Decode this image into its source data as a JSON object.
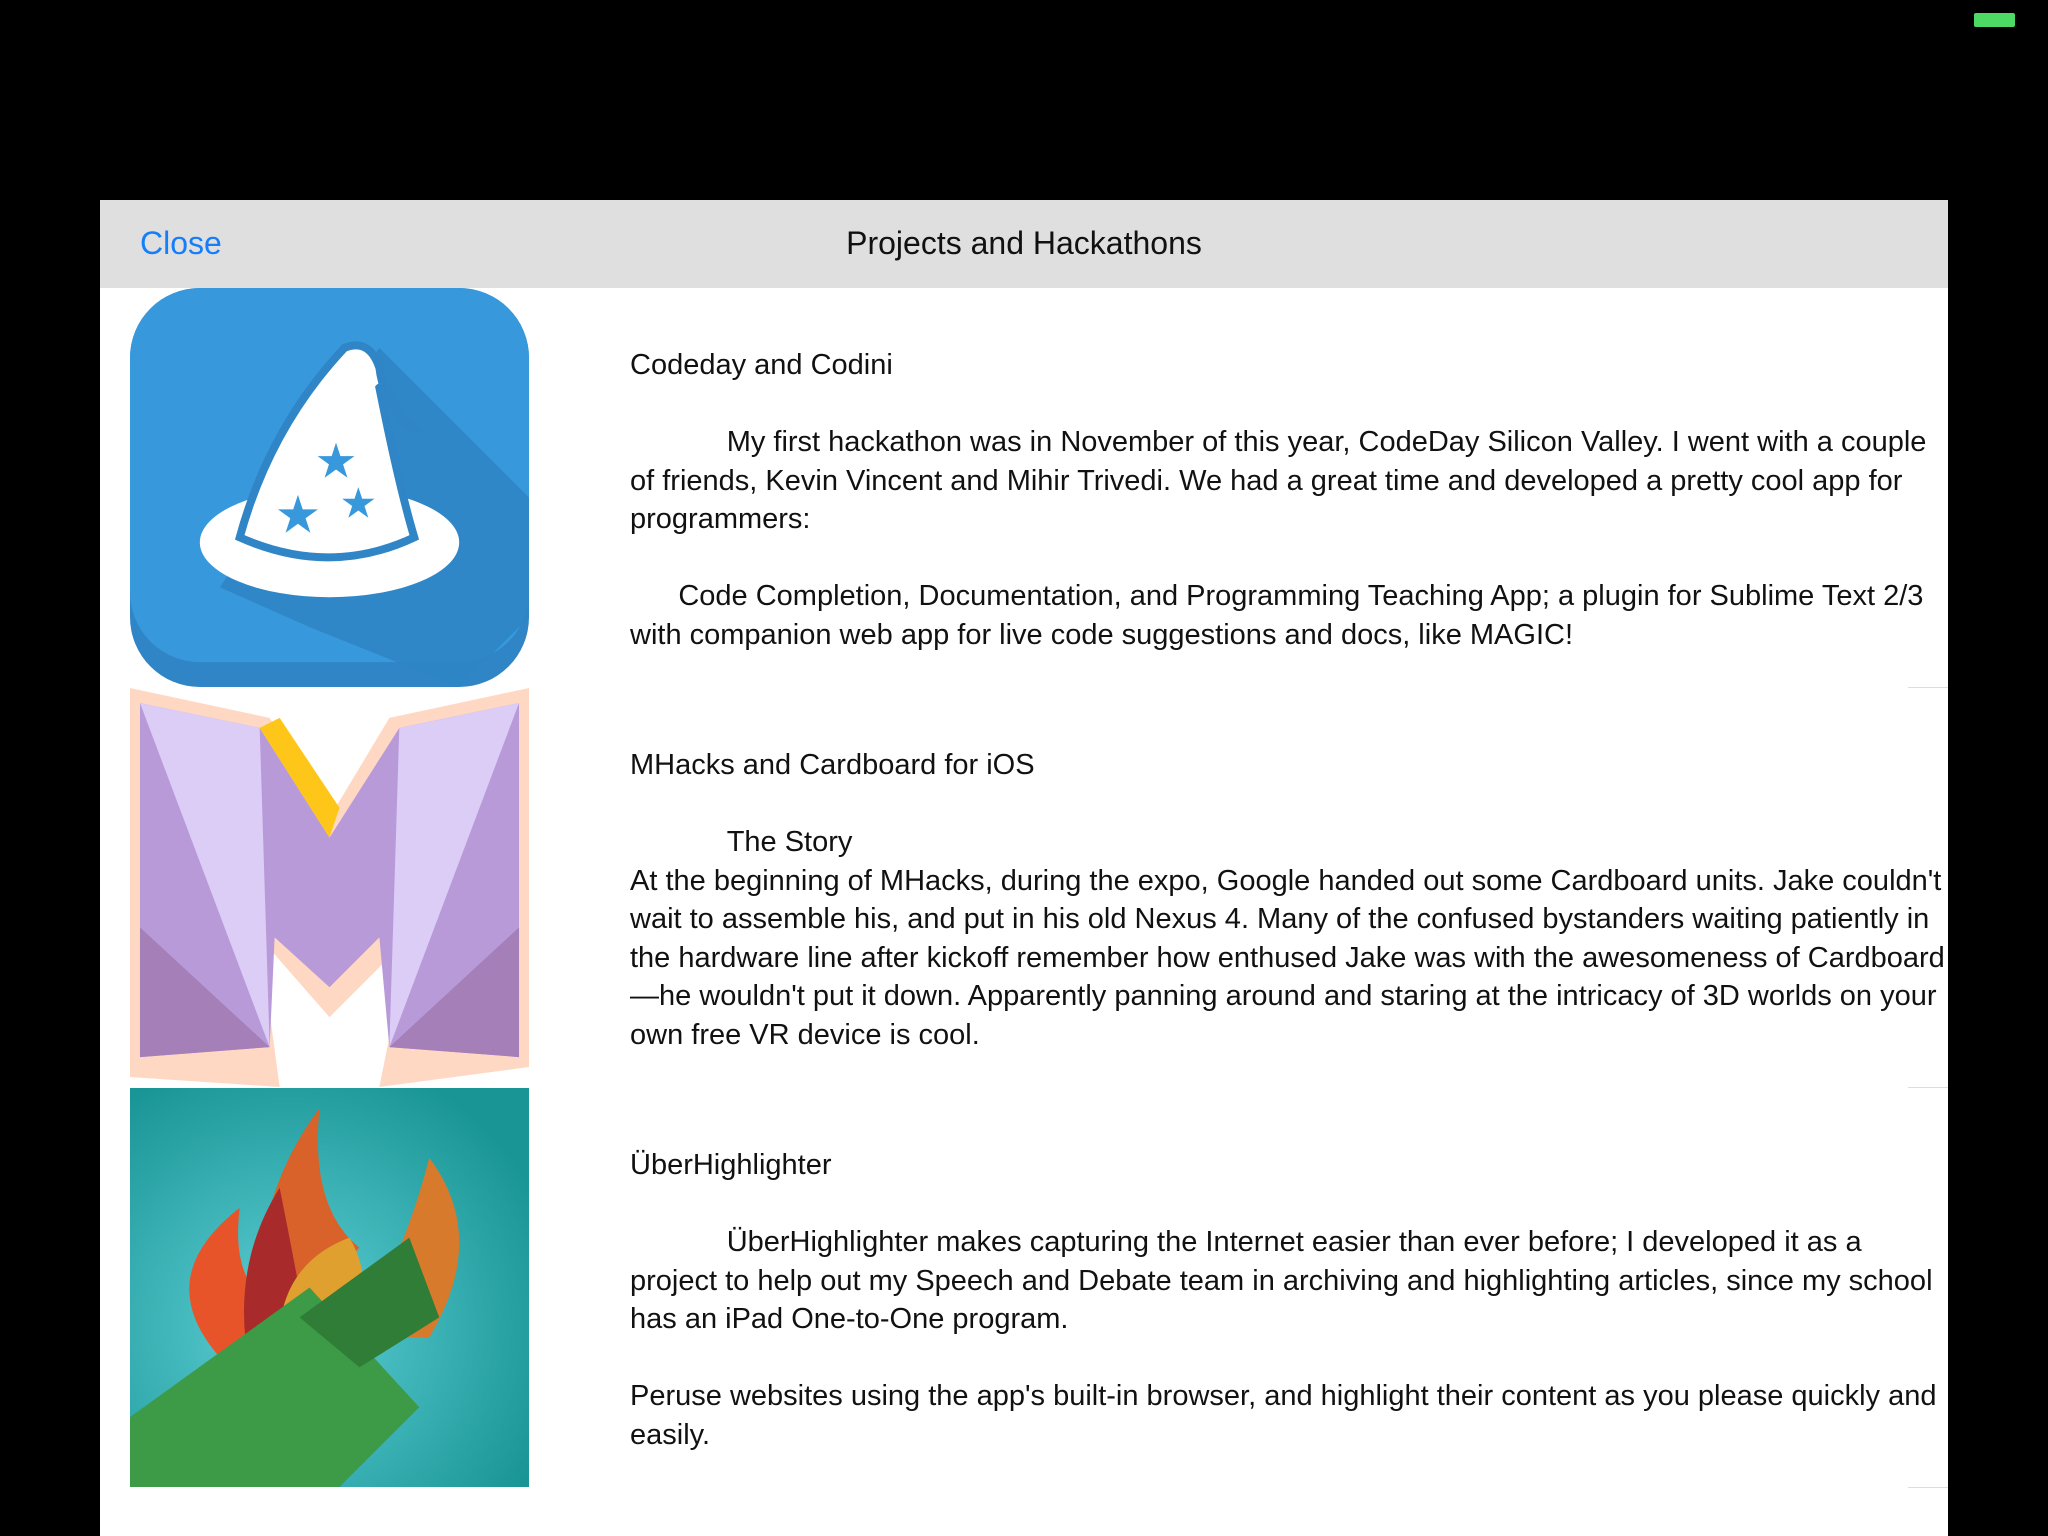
{
  "status_bar": {
    "battery_color": "#4cd964"
  },
  "header": {
    "close_label": "Close",
    "title": "Projects and Hackathons"
  },
  "projects": [
    {
      "icon": "wizard-hat-icon",
      "text": "Codeday and Codini\n\n            My first hackathon was in November of this year, CodeDay Silicon Valley. I went with a couple of friends, Kevin Vincent and Mihir Trivedi. We had a great time and developed a pretty cool app for programmers:\n\n      Code Completion, Documentation, and Programming Teaching App; a plugin for Sublime Text 2/3 with companion web app for live code suggestions and docs, like MAGIC!"
    },
    {
      "icon": "mhacks-logo-icon",
      "text": "MHacks and Cardboard for iOS\n\n            The Story\nAt the beginning of MHacks, during the expo, Google handed out some Cardboard units. Jake couldn't wait to assemble his, and put in his old Nexus 4. Many of the confused bystanders waiting patiently in the hardware line after kickoff remember how enthused Jake was with the awesomeness of Cardboard—he wouldn't put it down. Apparently panning around and staring at the intricacy of 3D worlds on your own free VR device is cool."
    },
    {
      "icon": "flame-highlighter-icon",
      "text": "ÜberHighlighter\n\n            ÜberHighlighter makes capturing the Internet easier than ever before; I developed it as a project to help out my Speech and Debate team in archiving and highlighting articles, since my school has an iPad One-to-One program.\n\nPeruse websites using the app's built-in browser, and highlight their content as you please quickly and easily."
    }
  ]
}
